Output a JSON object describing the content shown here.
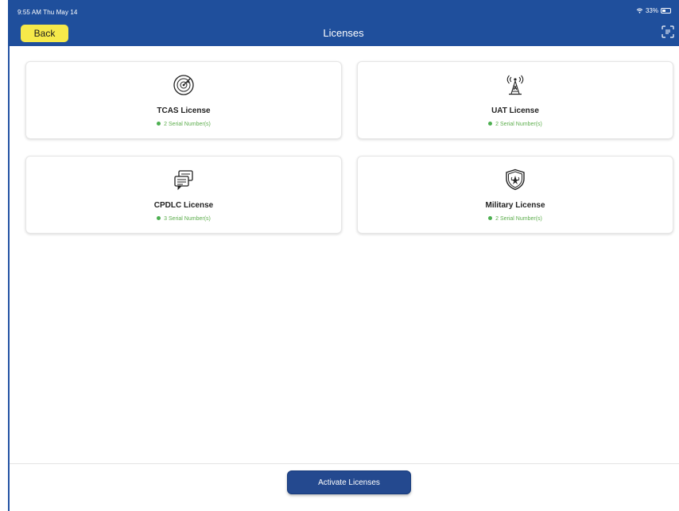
{
  "status_bar": {
    "time": "9:55 AM  Thu May 14",
    "battery_pct": "33%"
  },
  "header": {
    "back_label": "Back",
    "title": "Licenses"
  },
  "cards": [
    {
      "title": "TCAS License",
      "serials": "2 Serial Number(s)",
      "icon": "radar-icon"
    },
    {
      "title": "UAT License",
      "serials": "2 Serial Number(s)",
      "icon": "antenna-tower-icon"
    },
    {
      "title": "CPDLC License",
      "serials": "3 Serial Number(s)",
      "icon": "message-datalink-icon"
    },
    {
      "title": "Military License",
      "serials": "2 Serial Number(s)",
      "icon": "military-shield-icon"
    }
  ],
  "footer": {
    "activate_label": "Activate Licenses"
  },
  "colors": {
    "header": "#1f4f9c",
    "back_button": "#f6e94a",
    "status_dot": "#4caf50",
    "activate_button": "#24498f"
  }
}
